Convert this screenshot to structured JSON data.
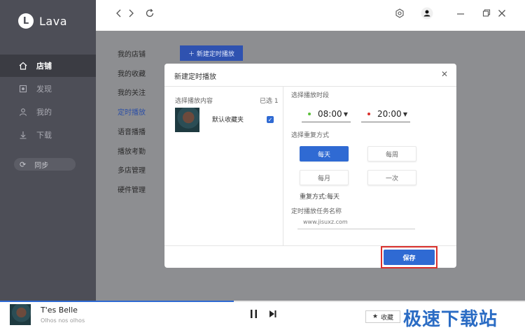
{
  "app": {
    "logo_letter": "L",
    "name": "Lava"
  },
  "sidebar": {
    "items": [
      {
        "label": "店铺",
        "icon": "home-icon"
      },
      {
        "label": "发现",
        "icon": "discover-icon"
      },
      {
        "label": "我的",
        "icon": "user-icon"
      },
      {
        "label": "下载",
        "icon": "download-icon"
      }
    ],
    "sync_label": "同步"
  },
  "submenu": [
    "我的店铺",
    "我的收藏",
    "我的关注",
    "定时播放",
    "语音播播",
    "播放考勤",
    "多店管理",
    "硬件管理"
  ],
  "new_schedule_button": "＋ 新建定时播放",
  "modal": {
    "title": "新建定时播放",
    "left_label": "选择播放内容",
    "selected_count": "已选 1",
    "playlist_name": "默认收藏夹",
    "time_label": "选择播放时段",
    "start_time": "08:00",
    "end_time": "20:00",
    "repeat_label": "选择重复方式",
    "repeat_options": [
      "每天",
      "每周",
      "每月",
      "一次"
    ],
    "repeat_summary": "重复方式:每天",
    "task_name_label": "定时播放任务名称",
    "task_name_value": "www.jisuxz.com",
    "save": "保存"
  },
  "player": {
    "title": "T'es Belle",
    "subtitle": "Olhos nos olhos",
    "favorite": "收藏",
    "progress": 0.445
  },
  "watermark": "极速下载站",
  "colors": {
    "accent": "#2f6ad3",
    "sidebar": "#4d4e57",
    "highlight": "#d9302c"
  }
}
